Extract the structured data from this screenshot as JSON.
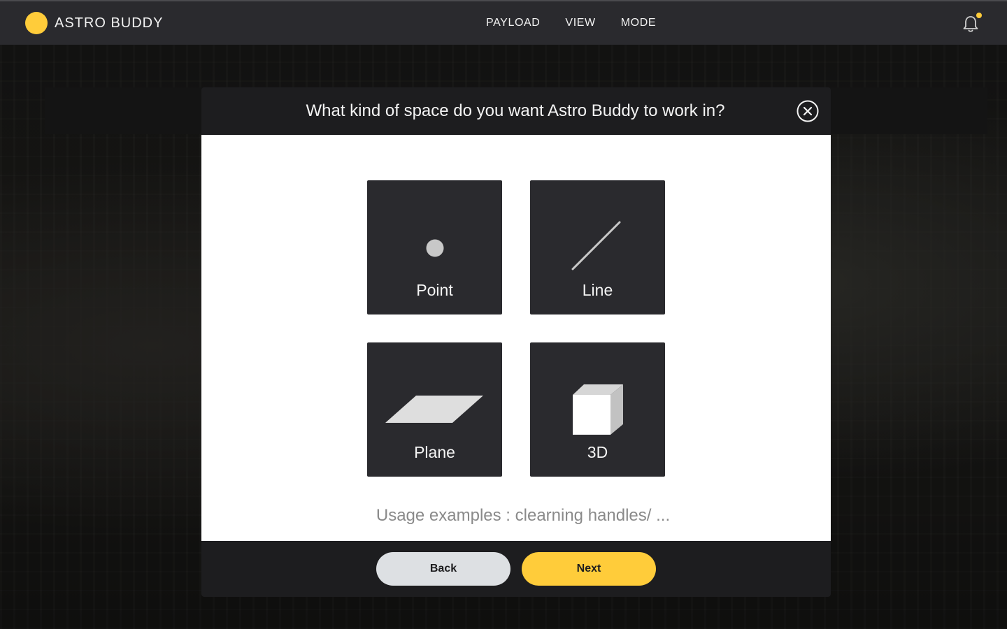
{
  "app": {
    "name": "ASTRO BUDDY",
    "brand_color": "#ffcc3a"
  },
  "nav": {
    "items": [
      {
        "label": "PAYLOAD"
      },
      {
        "label": "VIEW"
      },
      {
        "label": "MODE"
      }
    ],
    "notification_icon": "bell-icon",
    "has_unread": true
  },
  "modal": {
    "title": "What kind of space do you want Astro Buddy to work in?",
    "close_icon": "close-circle-icon",
    "options": [
      {
        "label": "Point",
        "icon": "point-icon"
      },
      {
        "label": "Line",
        "icon": "line-icon"
      },
      {
        "label": "Plane",
        "icon": "plane-icon"
      },
      {
        "label": "3D",
        "icon": "cube-icon"
      }
    ],
    "usage_text": "Usage examples : clearning handles/ ...",
    "back_label": "Back",
    "next_label": "Next"
  }
}
